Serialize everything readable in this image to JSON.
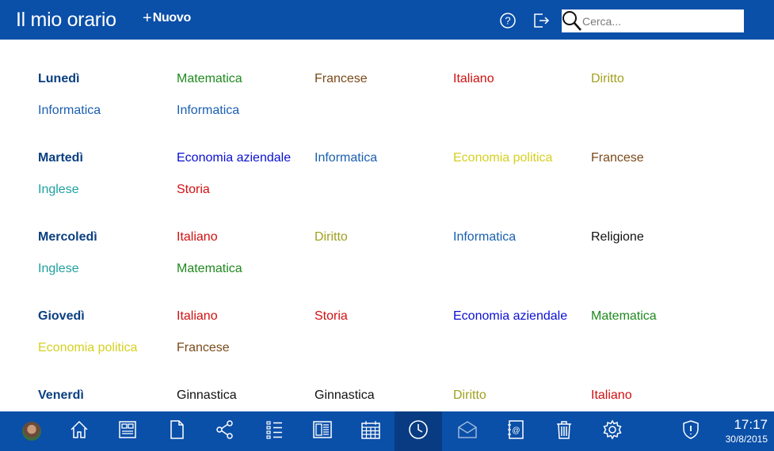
{
  "header": {
    "title": "Il mio orario",
    "new_plus": "+",
    "new_label": "Nuovo",
    "search_placeholder": "Cerca..."
  },
  "colors": {
    "header_bg": "#0a4fa8",
    "day": "#0a3f80",
    "Matematica": "#1e8a1e",
    "Francese": "#7a4a1a",
    "Italiano": "#d01010",
    "Diritto": "#a0a020",
    "Informatica": "#1a5fb0",
    "Economia aziendale": "#0a10d0",
    "Economia politica": "#d6d020",
    "Inglese": "#20a0a0",
    "Storia": "#d01010",
    "Religione": "#111111",
    "Ginnastica": "#111111"
  },
  "schedule": [
    {
      "day": "Lunedì",
      "subjects": [
        "Matematica",
        "Francese",
        "Italiano",
        "Diritto",
        "Informatica",
        "Informatica"
      ]
    },
    {
      "day": "Martedì",
      "subjects": [
        "Economia aziendale",
        "Informatica",
        "Economia politica",
        "Francese",
        "Inglese",
        "Storia"
      ]
    },
    {
      "day": "Mercoledì",
      "subjects": [
        "Italiano",
        "Diritto",
        "Informatica",
        "Religione",
        "Inglese",
        "Matematica"
      ]
    },
    {
      "day": "Giovedì",
      "subjects": [
        "Italiano",
        "Storia",
        "Economia aziendale",
        "Matematica",
        "Economia politica",
        "Francese"
      ]
    },
    {
      "day": "Venerdì",
      "subjects": [
        "Ginnastica",
        "Ginnastica",
        "Diritto",
        "Italiano"
      ]
    }
  ],
  "taskbar": {
    "items": [
      {
        "name": "home-icon"
      },
      {
        "name": "dashboard-icon"
      },
      {
        "name": "document-icon"
      },
      {
        "name": "share-icon"
      },
      {
        "name": "checklist-icon"
      },
      {
        "name": "newspaper-icon"
      },
      {
        "name": "calendar-icon"
      },
      {
        "name": "clock-icon",
        "active": true
      },
      {
        "name": "mail-icon"
      },
      {
        "name": "address-book-icon"
      },
      {
        "name": "trash-icon"
      },
      {
        "name": "settings-gear-icon"
      },
      {
        "name": "shield-icon"
      }
    ],
    "time": "17:17",
    "date": "30/8/2015"
  }
}
